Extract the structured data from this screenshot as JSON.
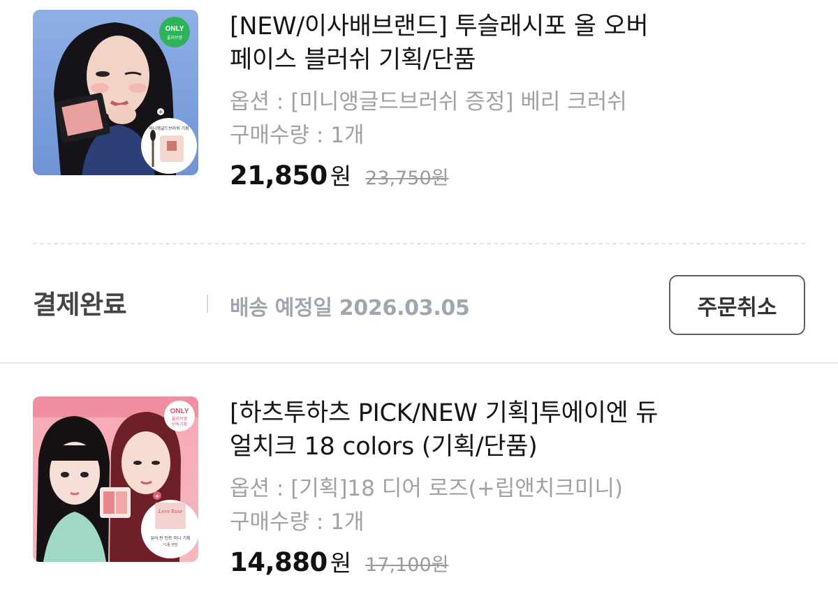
{
  "products": [
    {
      "title_line1": "[NEW/이사배브랜드] 투슬래시포 올 오버",
      "title_line2": "페이스 블러쉬 기획/단품",
      "option": "옵션 : [미니앵글드브러쉬 증정] 베리 크러쉬",
      "quantity": "구매수량 : 1개",
      "price": "21,850",
      "currency": "원",
      "original_price": "23,750원",
      "badge": {
        "line1": "ONLY",
        "line2": "올리브영"
      },
      "gift_caption": "미니앵글드브러쉬 기획"
    },
    {
      "title_line1": "[하츠투하츠 PICK/NEW 기획]투에이엔 듀",
      "title_line2": "얼치크 18 colors (기획/단품)",
      "option": "옵션 : [기획]18 디어 로즈(+립앤치크미니)",
      "quantity": "구매수량 : 1개",
      "price": "14,880",
      "currency": "원",
      "original_price": "17,100원",
      "badge": {
        "line1": "ONLY",
        "line2": "올리브영",
        "line3": "단독기획"
      },
      "gift_caption": "유어 틴 틴트 미니 기획",
      "gift_subcaption": "*1종 랜덤",
      "package_text": "Love Rose"
    }
  ],
  "order_status": {
    "label": "결제완료",
    "delivery_date": "배송 예정일 2026.03.05",
    "cancel_label": "주문취소"
  },
  "colors": {
    "badge_green": "#2fb35a",
    "status_gray": "#444444",
    "date_gray": "#9ea6b0",
    "muted_text": "#a1a1a1"
  }
}
